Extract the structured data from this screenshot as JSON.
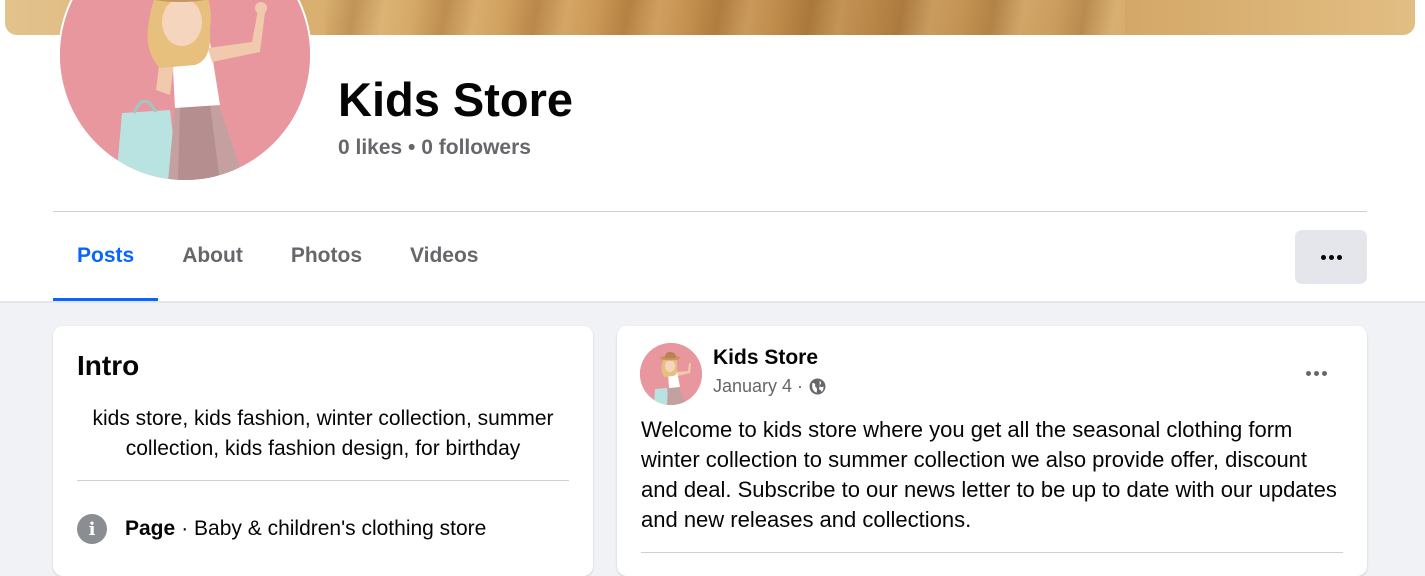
{
  "page": {
    "title": "Kids Store",
    "stats": "0 likes • 0 followers"
  },
  "tabs": [
    {
      "label": "Posts",
      "active": true
    },
    {
      "label": "About",
      "active": false
    },
    {
      "label": "Photos",
      "active": false
    },
    {
      "label": "Videos",
      "active": false
    }
  ],
  "more_button": {
    "icon": "more-horizontal-icon"
  },
  "intro": {
    "title": "Intro",
    "bio": "kids store, kids fashion, winter collection, summer collection, kids fashion design, for birthday",
    "category_label": "Page",
    "category_value": " · Baby & children's clothing store",
    "category_icon": "info-icon"
  },
  "post": {
    "author": "Kids Store",
    "date": "January 4 ·",
    "audience_icon": "globe-icon",
    "text": "Welcome to kids store where you get all the seasonal clothing form winter collection to summer collection we also provide offer, discount and deal. Subscribe to our news letter to be up to date with our updates and new releases and collections."
  },
  "colors": {
    "accent": "#0866ff",
    "secondary_text": "#65676b",
    "background": "#f0f2f5",
    "avatar_bg": "#e8979f"
  }
}
